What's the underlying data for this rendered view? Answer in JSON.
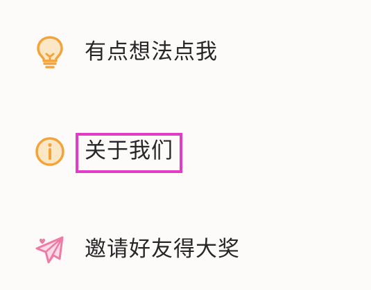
{
  "menu": {
    "items": [
      {
        "label": "有点想法点我",
        "icon": "lightbulb-icon"
      },
      {
        "label": "关于我们",
        "icon": "info-icon"
      },
      {
        "label": "邀请好友得大奖",
        "icon": "paper-plane-icon"
      }
    ]
  },
  "colors": {
    "background": "#fdfbf9",
    "text": "#262626",
    "icon_orange": "#f2a33a",
    "icon_pink": "#ee7aa6",
    "highlight": "#e23cc6"
  }
}
